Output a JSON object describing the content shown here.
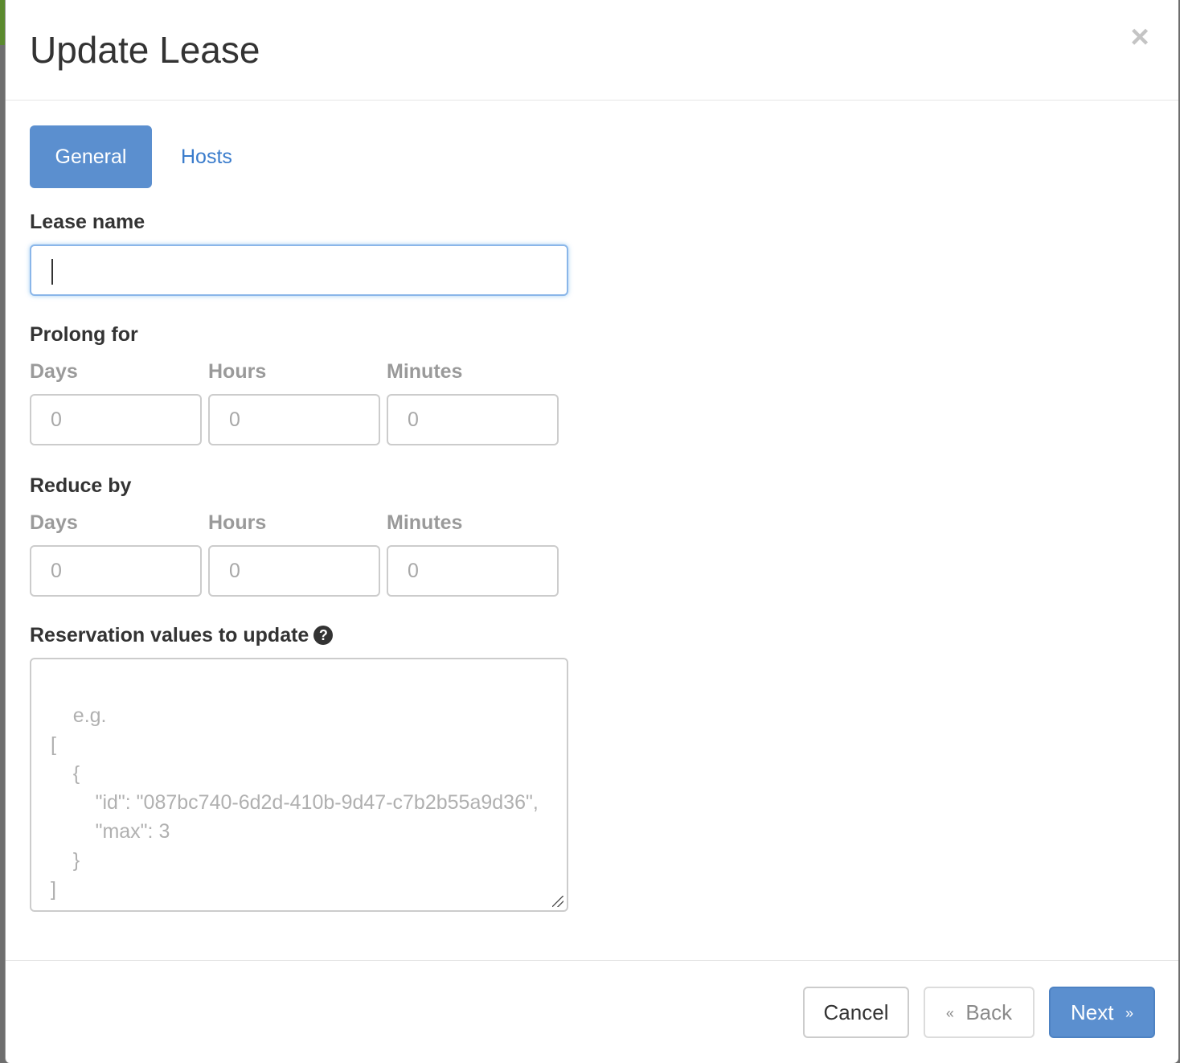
{
  "colors": {
    "primary": "#5b8fcf",
    "link": "#3a7ccc",
    "focus_border": "#8ab6e9",
    "muted_label": "#9a9a9a"
  },
  "modal": {
    "title": "Update Lease",
    "close_icon": "×"
  },
  "tabs": [
    {
      "label": "General",
      "active": true
    },
    {
      "label": "Hosts",
      "active": false
    }
  ],
  "form": {
    "lease_name": {
      "label": "Lease name",
      "value": ""
    },
    "prolong": {
      "label": "Prolong for",
      "days": {
        "label": "Days",
        "placeholder": "0"
      },
      "hours": {
        "label": "Hours",
        "placeholder": "0"
      },
      "minutes": {
        "label": "Minutes",
        "placeholder": "0"
      }
    },
    "reduce": {
      "label": "Reduce by",
      "days": {
        "label": "Days",
        "placeholder": "0"
      },
      "hours": {
        "label": "Hours",
        "placeholder": "0"
      },
      "minutes": {
        "label": "Minutes",
        "placeholder": "0"
      }
    },
    "reservation": {
      "label": "Reservation values to update",
      "help_icon": "question-circle-icon",
      "placeholder": "e.g.\n[\n    {\n        \"id\": \"087bc740-6d2d-410b-9d47-c7b2b55a9d36\",\n        \"max\": 3\n    }\n]"
    }
  },
  "footer": {
    "cancel_label": "Cancel",
    "back_arrow": "«",
    "back_label": "Back",
    "next_label": "Next",
    "next_arrow": "»"
  }
}
